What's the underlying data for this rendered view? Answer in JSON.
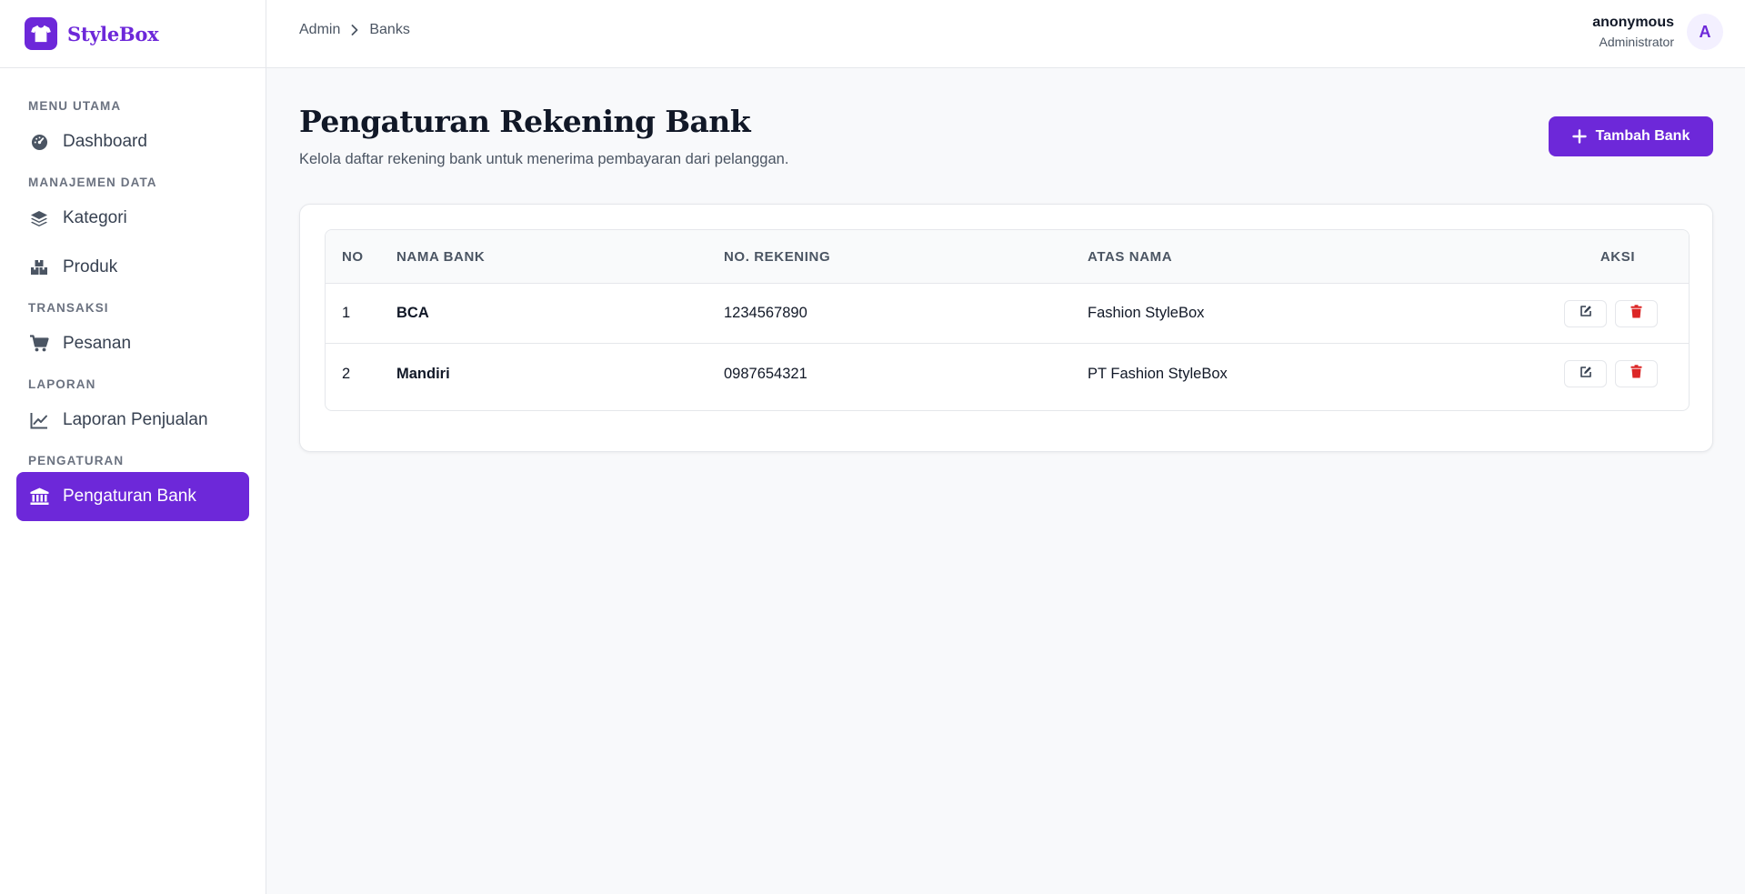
{
  "app": {
    "name": "StyleBox"
  },
  "breadcrumb": [
    "Admin",
    "Banks"
  ],
  "user": {
    "name": "anonymous",
    "role": "Administrator",
    "initial": "A"
  },
  "sidebar": {
    "sections": [
      {
        "heading": "MENU UTAMA",
        "items": [
          {
            "label": "Dashboard",
            "icon": "gauge-icon"
          }
        ]
      },
      {
        "heading": "MANAJEMEN DATA",
        "items": [
          {
            "label": "Kategori",
            "icon": "layers-icon"
          },
          {
            "label": "Produk",
            "icon": "boxes-icon"
          }
        ]
      },
      {
        "heading": "TRANSAKSI",
        "items": [
          {
            "label": "Pesanan",
            "icon": "cart-icon"
          }
        ]
      },
      {
        "heading": "LAPORAN",
        "items": [
          {
            "label": "Laporan Penjualan",
            "icon": "line-chart-icon"
          }
        ]
      },
      {
        "heading": "PENGATURAN",
        "items": [
          {
            "label": "Pengaturan Bank",
            "icon": "bank-icon",
            "active": true
          }
        ]
      }
    ]
  },
  "page": {
    "title": "Pengaturan Rekening Bank",
    "subtitle": "Kelola daftar rekening bank untuk menerima pembayaran dari pelanggan.",
    "add_button": "Tambah Bank"
  },
  "table": {
    "headers": {
      "no": "NO",
      "name": "NAMA BANK",
      "account": "NO. REKENING",
      "owner": "ATAS NAMA",
      "actions": "AKSI"
    },
    "rows": [
      {
        "no": "1",
        "name": "BCA",
        "account": "1234567890",
        "owner": "Fashion StyleBox"
      },
      {
        "no": "2",
        "name": "Mandiri",
        "account": "0987654321",
        "owner": "PT Fashion StyleBox"
      }
    ]
  },
  "colors": {
    "accent": "#6d28d9",
    "danger": "#dc2626",
    "background": "#f8f9fb"
  }
}
